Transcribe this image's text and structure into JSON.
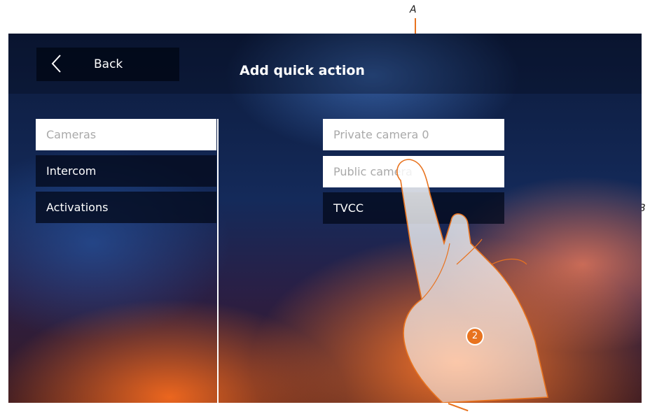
{
  "header": {
    "back_label": "Back",
    "title": "Add quick action"
  },
  "categories": [
    {
      "label": "Cameras",
      "selected": true
    },
    {
      "label": "Intercom",
      "selected": false
    },
    {
      "label": "Activations",
      "selected": false
    }
  ],
  "cameras": [
    {
      "label": "Private camera 0",
      "selected": true
    },
    {
      "label": "Public camera",
      "selected": true
    },
    {
      "label": "TVCC",
      "selected": false
    }
  ],
  "annotations": {
    "callout_a": "A",
    "callout_b": "B",
    "step_number": "2"
  },
  "colors": {
    "accent": "#e8731f",
    "item_dark": "#040a1c",
    "item_light": "#ffffff"
  },
  "icons": {
    "back": "chevron-left-icon",
    "gesture": "pointing-hand-icon"
  }
}
